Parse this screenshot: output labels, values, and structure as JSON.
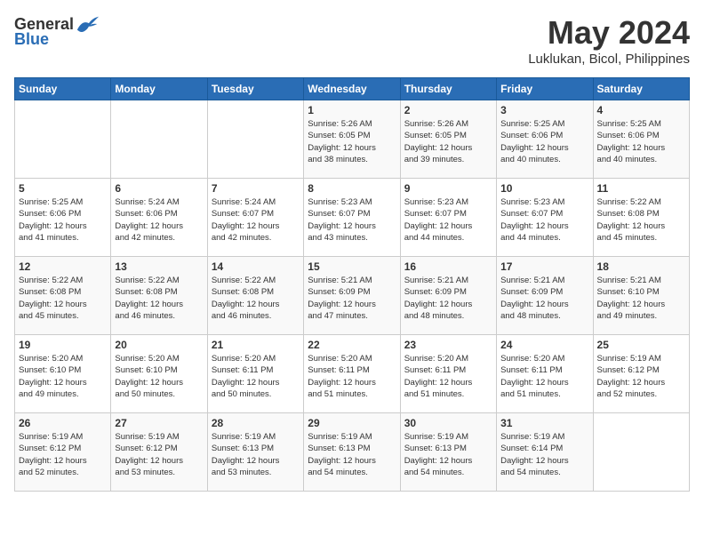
{
  "header": {
    "logo_general": "General",
    "logo_blue": "Blue",
    "month_year": "May 2024",
    "location": "Luklukan, Bicol, Philippines"
  },
  "weekdays": [
    "Sunday",
    "Monday",
    "Tuesday",
    "Wednesday",
    "Thursday",
    "Friday",
    "Saturday"
  ],
  "weeks": [
    [
      {
        "day": "",
        "info": ""
      },
      {
        "day": "",
        "info": ""
      },
      {
        "day": "",
        "info": ""
      },
      {
        "day": "1",
        "info": "Sunrise: 5:26 AM\nSunset: 6:05 PM\nDaylight: 12 hours\nand 38 minutes."
      },
      {
        "day": "2",
        "info": "Sunrise: 5:26 AM\nSunset: 6:05 PM\nDaylight: 12 hours\nand 39 minutes."
      },
      {
        "day": "3",
        "info": "Sunrise: 5:25 AM\nSunset: 6:06 PM\nDaylight: 12 hours\nand 40 minutes."
      },
      {
        "day": "4",
        "info": "Sunrise: 5:25 AM\nSunset: 6:06 PM\nDaylight: 12 hours\nand 40 minutes."
      }
    ],
    [
      {
        "day": "5",
        "info": "Sunrise: 5:25 AM\nSunset: 6:06 PM\nDaylight: 12 hours\nand 41 minutes."
      },
      {
        "day": "6",
        "info": "Sunrise: 5:24 AM\nSunset: 6:06 PM\nDaylight: 12 hours\nand 42 minutes."
      },
      {
        "day": "7",
        "info": "Sunrise: 5:24 AM\nSunset: 6:07 PM\nDaylight: 12 hours\nand 42 minutes."
      },
      {
        "day": "8",
        "info": "Sunrise: 5:23 AM\nSunset: 6:07 PM\nDaylight: 12 hours\nand 43 minutes."
      },
      {
        "day": "9",
        "info": "Sunrise: 5:23 AM\nSunset: 6:07 PM\nDaylight: 12 hours\nand 44 minutes."
      },
      {
        "day": "10",
        "info": "Sunrise: 5:23 AM\nSunset: 6:07 PM\nDaylight: 12 hours\nand 44 minutes."
      },
      {
        "day": "11",
        "info": "Sunrise: 5:22 AM\nSunset: 6:08 PM\nDaylight: 12 hours\nand 45 minutes."
      }
    ],
    [
      {
        "day": "12",
        "info": "Sunrise: 5:22 AM\nSunset: 6:08 PM\nDaylight: 12 hours\nand 45 minutes."
      },
      {
        "day": "13",
        "info": "Sunrise: 5:22 AM\nSunset: 6:08 PM\nDaylight: 12 hours\nand 46 minutes."
      },
      {
        "day": "14",
        "info": "Sunrise: 5:22 AM\nSunset: 6:08 PM\nDaylight: 12 hours\nand 46 minutes."
      },
      {
        "day": "15",
        "info": "Sunrise: 5:21 AM\nSunset: 6:09 PM\nDaylight: 12 hours\nand 47 minutes."
      },
      {
        "day": "16",
        "info": "Sunrise: 5:21 AM\nSunset: 6:09 PM\nDaylight: 12 hours\nand 48 minutes."
      },
      {
        "day": "17",
        "info": "Sunrise: 5:21 AM\nSunset: 6:09 PM\nDaylight: 12 hours\nand 48 minutes."
      },
      {
        "day": "18",
        "info": "Sunrise: 5:21 AM\nSunset: 6:10 PM\nDaylight: 12 hours\nand 49 minutes."
      }
    ],
    [
      {
        "day": "19",
        "info": "Sunrise: 5:20 AM\nSunset: 6:10 PM\nDaylight: 12 hours\nand 49 minutes."
      },
      {
        "day": "20",
        "info": "Sunrise: 5:20 AM\nSunset: 6:10 PM\nDaylight: 12 hours\nand 50 minutes."
      },
      {
        "day": "21",
        "info": "Sunrise: 5:20 AM\nSunset: 6:11 PM\nDaylight: 12 hours\nand 50 minutes."
      },
      {
        "day": "22",
        "info": "Sunrise: 5:20 AM\nSunset: 6:11 PM\nDaylight: 12 hours\nand 51 minutes."
      },
      {
        "day": "23",
        "info": "Sunrise: 5:20 AM\nSunset: 6:11 PM\nDaylight: 12 hours\nand 51 minutes."
      },
      {
        "day": "24",
        "info": "Sunrise: 5:20 AM\nSunset: 6:11 PM\nDaylight: 12 hours\nand 51 minutes."
      },
      {
        "day": "25",
        "info": "Sunrise: 5:19 AM\nSunset: 6:12 PM\nDaylight: 12 hours\nand 52 minutes."
      }
    ],
    [
      {
        "day": "26",
        "info": "Sunrise: 5:19 AM\nSunset: 6:12 PM\nDaylight: 12 hours\nand 52 minutes."
      },
      {
        "day": "27",
        "info": "Sunrise: 5:19 AM\nSunset: 6:12 PM\nDaylight: 12 hours\nand 53 minutes."
      },
      {
        "day": "28",
        "info": "Sunrise: 5:19 AM\nSunset: 6:13 PM\nDaylight: 12 hours\nand 53 minutes."
      },
      {
        "day": "29",
        "info": "Sunrise: 5:19 AM\nSunset: 6:13 PM\nDaylight: 12 hours\nand 54 minutes."
      },
      {
        "day": "30",
        "info": "Sunrise: 5:19 AM\nSunset: 6:13 PM\nDaylight: 12 hours\nand 54 minutes."
      },
      {
        "day": "31",
        "info": "Sunrise: 5:19 AM\nSunset: 6:14 PM\nDaylight: 12 hours\nand 54 minutes."
      },
      {
        "day": "",
        "info": ""
      }
    ]
  ]
}
